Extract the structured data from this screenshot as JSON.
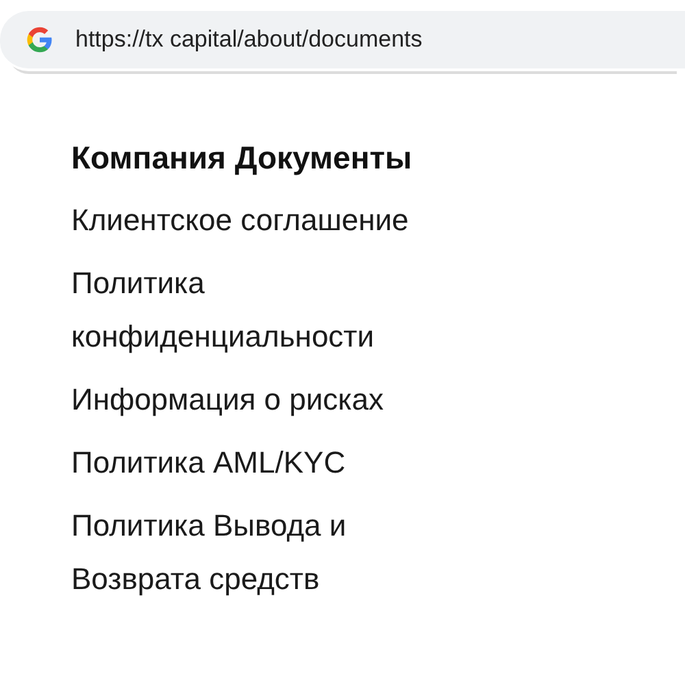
{
  "address_bar": {
    "url": "https://tx capital/about/documents"
  },
  "section": {
    "title": "Компания Документы",
    "links": [
      "Клиентское соглашение",
      "Политика конфиденциальности",
      "Информация о рисках",
      "Политика AML/KYC",
      "Политика Вывода и Возврата средств"
    ]
  }
}
